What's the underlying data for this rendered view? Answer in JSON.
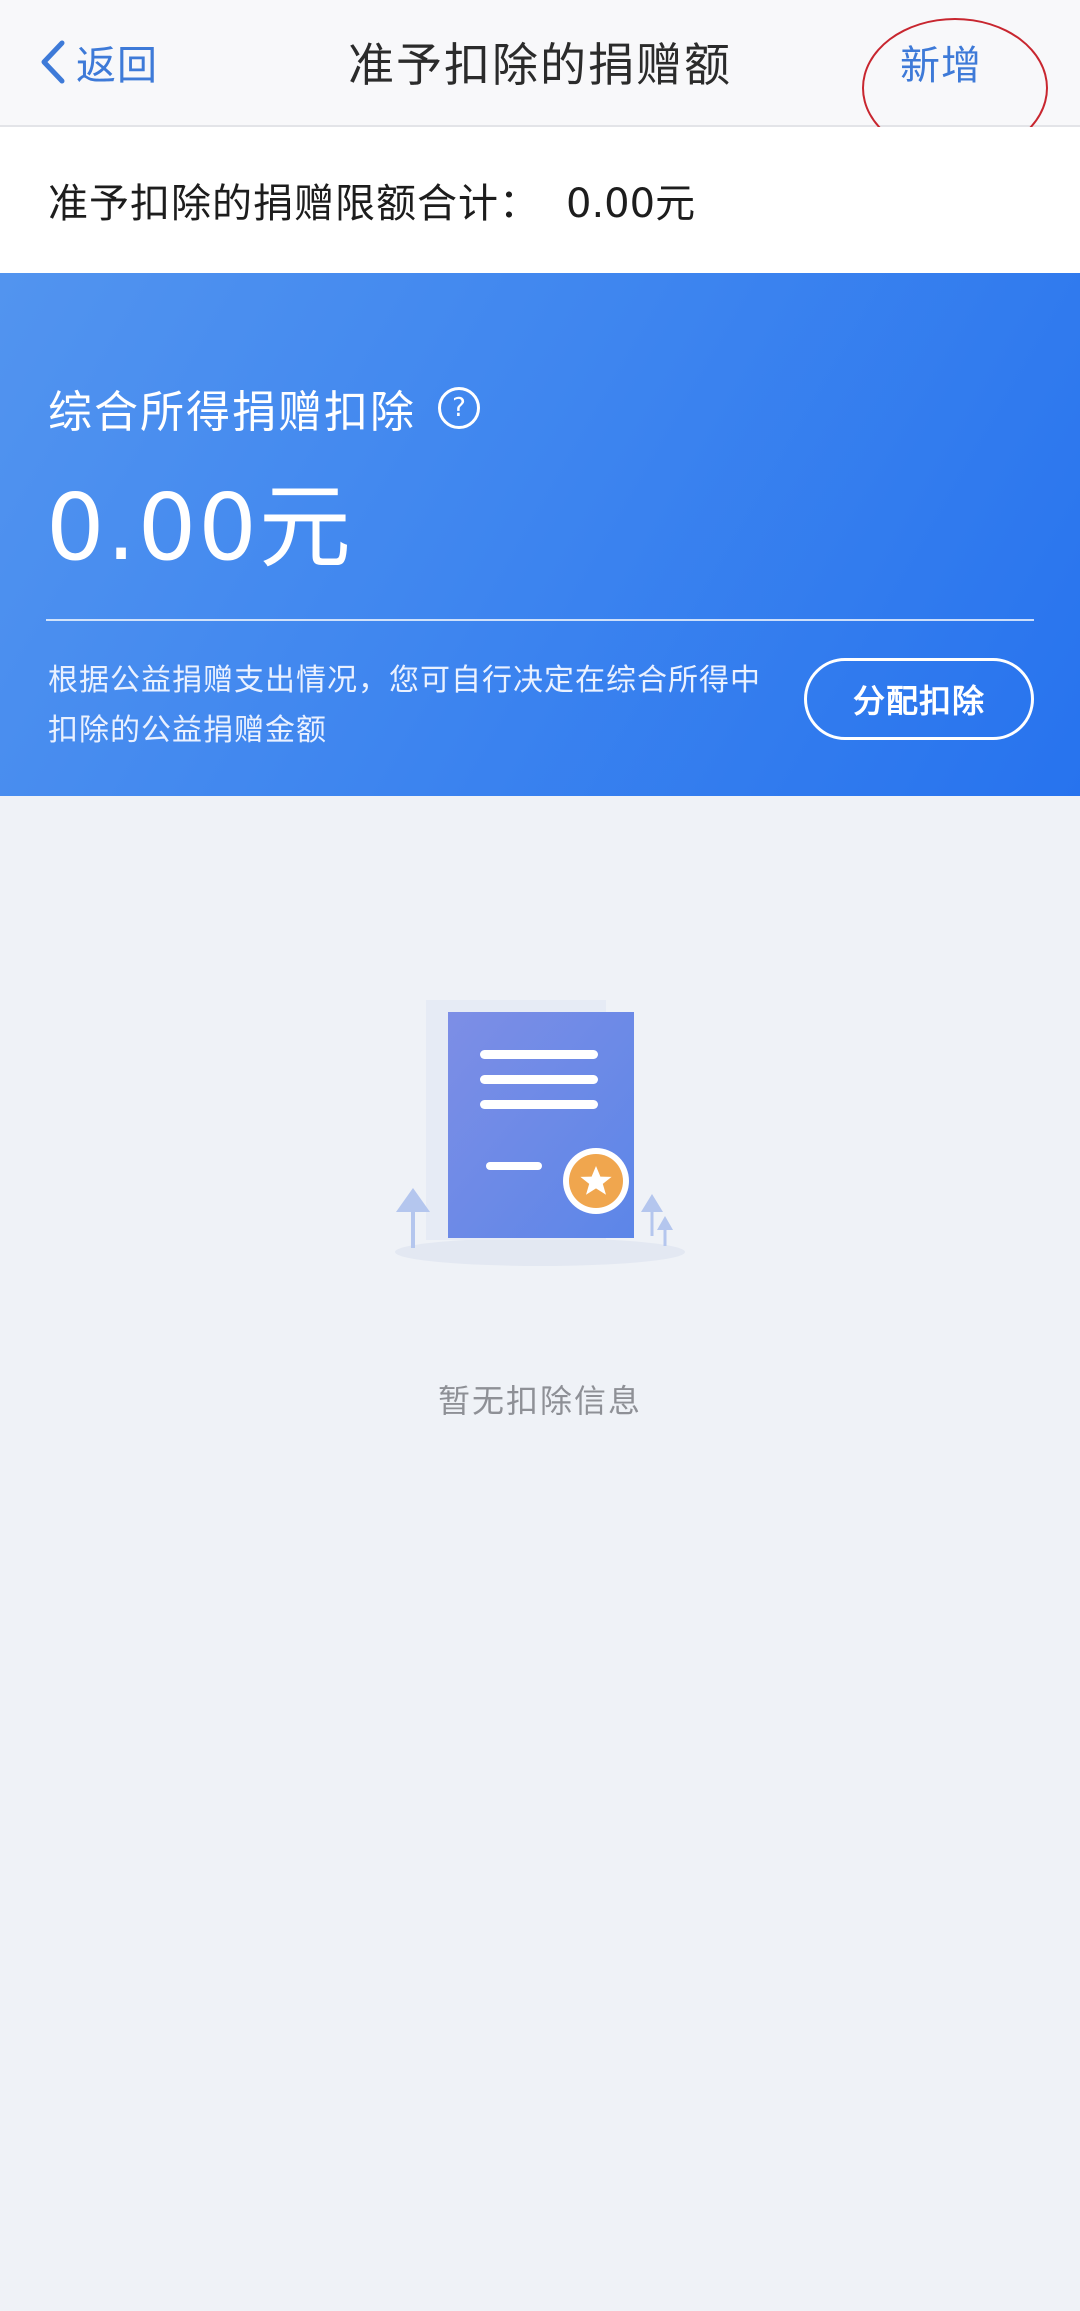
{
  "nav": {
    "back_label": "返回",
    "title": "准予扣除的捐赠额",
    "add_label": "新增"
  },
  "limit": {
    "label": "准予扣除的捐赠限额合计：",
    "value": "0.00元"
  },
  "card": {
    "title": "综合所得捐赠扣除",
    "amount": "0.00元",
    "description": "根据公益捐赠支出情况，您可自行决定在综合所得中扣除的公益捐赠金额",
    "allocate_label": "分配扣除"
  },
  "empty_state": {
    "text": "暂无扣除信息"
  },
  "icons": {
    "back": "chevron-left-icon",
    "help": "question-circle-icon",
    "empty": "document-star-illustration"
  },
  "colors": {
    "link": "#3e7ad8",
    "card_start": "#5294ef",
    "card_end": "#2773ee",
    "annotation": "#e0141e"
  }
}
